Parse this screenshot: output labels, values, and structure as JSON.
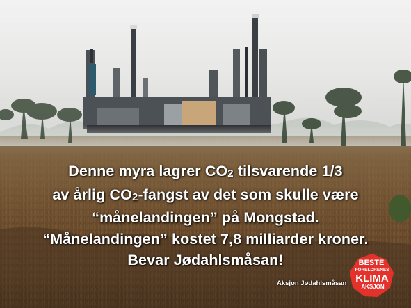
{
  "message": {
    "line1_a": "Denne myra lagrer CO",
    "line1_sub": "2",
    "line1_b": " tilsvarende 1/3",
    "line2_a": "av årlig CO",
    "line2_sub": "2",
    "line2_b": "-fangst av det som skulle være",
    "line3": "“månelandingen” på Mongstad.",
    "line4": "“Månelandingen” kostet 7,8 milliarder kroner.",
    "line5": "Bevar Jødahlsmåsan!"
  },
  "credit": "Aksjon Jødahlsmåsan",
  "badge": {
    "line1": "BESTE",
    "line2": "FORELDRENES",
    "line3": "KLIMA",
    "line4": "AKSJON",
    "color": "#e3322b"
  },
  "colors": {
    "sky": "#e8e8e8",
    "bog_brown": "#6e5233",
    "text": "#ffffff"
  }
}
